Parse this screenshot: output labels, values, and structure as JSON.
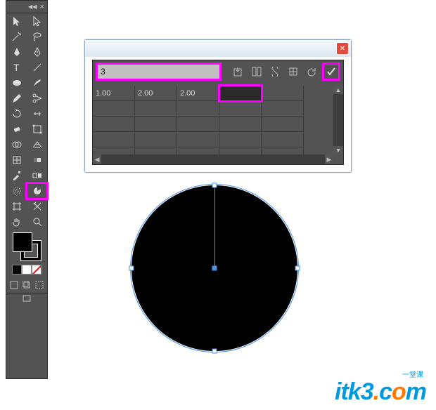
{
  "tools": {
    "selection": "selection-tool",
    "direct_selection": "direct-selection-tool",
    "magic_wand": "magic-wand-tool",
    "lasso": "lasso-tool",
    "pen": "pen-tool",
    "curvature": "curvature-tool",
    "type": "type-tool",
    "line_segment": "line-segment-tool",
    "shape": "ellipse-tool",
    "brush": "paintbrush-tool",
    "pencil": "pencil-tool",
    "scissors": "scissors-tool",
    "rotate": "rotate-tool",
    "reflect": "width-tool",
    "eraser": "eraser-tool",
    "scale": "free-transform-tool",
    "shape_builder": "shape-builder-tool",
    "perspective": "perspective-grid-tool",
    "mesh": "mesh-tool",
    "gradient": "gradient-tool",
    "eyedropper": "eyedropper-tool",
    "blend": "blend-tool",
    "symbol_sprayer": "symbol-sprayer-tool",
    "column_graph": "pie-graph-tool",
    "artboard": "artboard-tool",
    "slice": "slice-tool",
    "hand": "hand-tool",
    "zoom": "zoom-tool"
  },
  "transform_panel": {
    "input_value": "3",
    "row_values": [
      "1.00",
      "2.00",
      "2.00",
      ""
    ]
  },
  "colors": {
    "fill": "#000000",
    "stroke": "none",
    "highlight": "#ff00ff",
    "selection": "#4a90e2"
  },
  "watermark": {
    "text_prefix": "itk3",
    "dot": ".",
    "c": "c",
    "o": "o",
    "m": "m",
    "sub": "一堂课"
  }
}
